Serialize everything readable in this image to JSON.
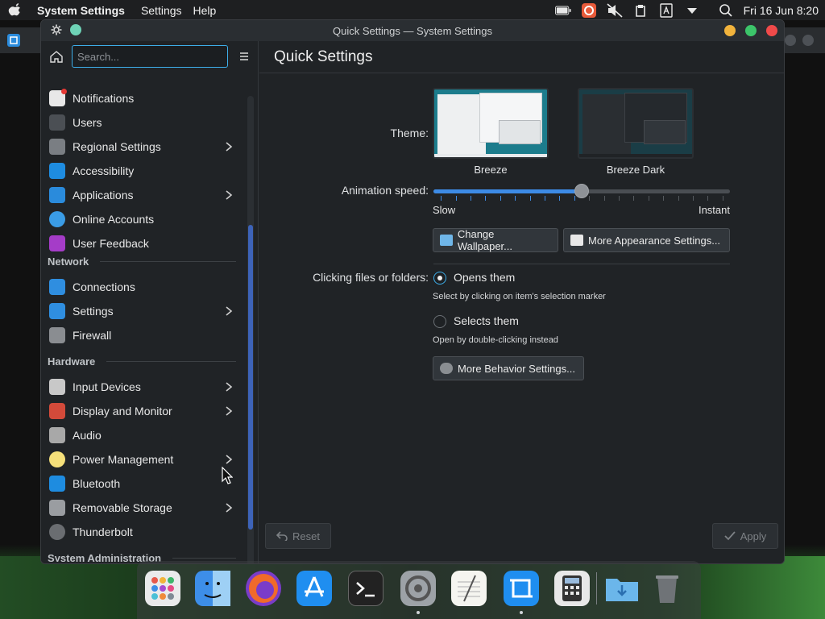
{
  "menubar": {
    "app_name": "System Settings",
    "menus": [
      "Settings",
      "Help"
    ],
    "clock": "Fri 16 Jun  8:20"
  },
  "window": {
    "title": "Quick Settings — System Settings"
  },
  "sidebar": {
    "search_placeholder": "Search...",
    "items": [
      {
        "label": "Notifications",
        "icon": "notifications-icon",
        "color": "#e8e8e8",
        "chevron": false
      },
      {
        "label": "Users",
        "icon": "users-icon",
        "color": "#4b4f54",
        "chevron": false
      },
      {
        "label": "Regional Settings",
        "icon": "regional-settings-icon",
        "color": "#7a7e83",
        "chevron": true
      },
      {
        "label": "Accessibility",
        "icon": "accessibility-icon",
        "color": "#1e8ce0",
        "chevron": false
      },
      {
        "label": "Applications",
        "icon": "applications-icon",
        "color": "#2a8bdc",
        "chevron": true
      },
      {
        "label": "Online Accounts",
        "icon": "online-accounts-icon",
        "color": "#3a9ce6",
        "chevron": false
      },
      {
        "label": "User Feedback",
        "icon": "user-feedback-icon",
        "color": "#a53cc8",
        "chevron": false
      }
    ],
    "network_header": "Network",
    "network_items": [
      {
        "label": "Connections",
        "icon": "connections-icon",
        "color": "#2f8ee0",
        "chevron": false
      },
      {
        "label": "Settings",
        "icon": "network-settings-icon",
        "color": "#2f8ee0",
        "chevron": true
      },
      {
        "label": "Firewall",
        "icon": "firewall-icon",
        "color": "#8a8d91",
        "chevron": false
      }
    ],
    "hardware_header": "Hardware",
    "hardware_items": [
      {
        "label": "Input Devices",
        "icon": "input-devices-icon",
        "color": "#c8c8c8",
        "chevron": true
      },
      {
        "label": "Display and Monitor",
        "icon": "display-monitor-icon",
        "color": "#d34a3a",
        "chevron": true
      },
      {
        "label": "Audio",
        "icon": "audio-icon",
        "color": "#a8a8a8",
        "chevron": false
      },
      {
        "label": "Power Management",
        "icon": "power-management-icon",
        "color": "#f5e07a",
        "chevron": true
      },
      {
        "label": "Bluetooth",
        "icon": "bluetooth-icon",
        "color": "#1e8ce0",
        "chevron": false
      },
      {
        "label": "Removable Storage",
        "icon": "removable-storage-icon",
        "color": "#9a9da1",
        "chevron": true
      },
      {
        "label": "Thunderbolt",
        "icon": "thunderbolt-icon",
        "color": "#6a6d71",
        "chevron": false
      }
    ],
    "sysadmin_header": "System Administration"
  },
  "content": {
    "title": "Quick Settings",
    "theme_label": "Theme:",
    "themes": [
      "Breeze",
      "Breeze Dark"
    ],
    "animation_label": "Animation speed:",
    "animation_speed": 0.5,
    "slider_min": "Slow",
    "slider_max": "Instant",
    "change_wallpaper": "Change Wallpaper...",
    "more_appearance": "More Appearance Settings...",
    "clicking_label": "Clicking files or folders:",
    "opt_open": "Opens them",
    "opt_open_hint": "Select by clicking on item's selection marker",
    "opt_select": "Selects them",
    "opt_select_hint": "Open by double-clicking instead",
    "more_behavior": "More Behavior Settings...",
    "reset": "Reset",
    "apply": "Apply"
  },
  "dock": {
    "apps": [
      "launchpad-icon",
      "finder-icon",
      "firefox-icon",
      "app-store-icon",
      "terminal-icon",
      "system-settings-icon",
      "notes-icon",
      "screen-tool-icon",
      "calculator-icon",
      "downloads-folder-icon",
      "trash-icon"
    ]
  },
  "colors": {
    "accent": "#3daee9",
    "slider_fill": "#3d8be6",
    "window_bg": "#202326"
  }
}
